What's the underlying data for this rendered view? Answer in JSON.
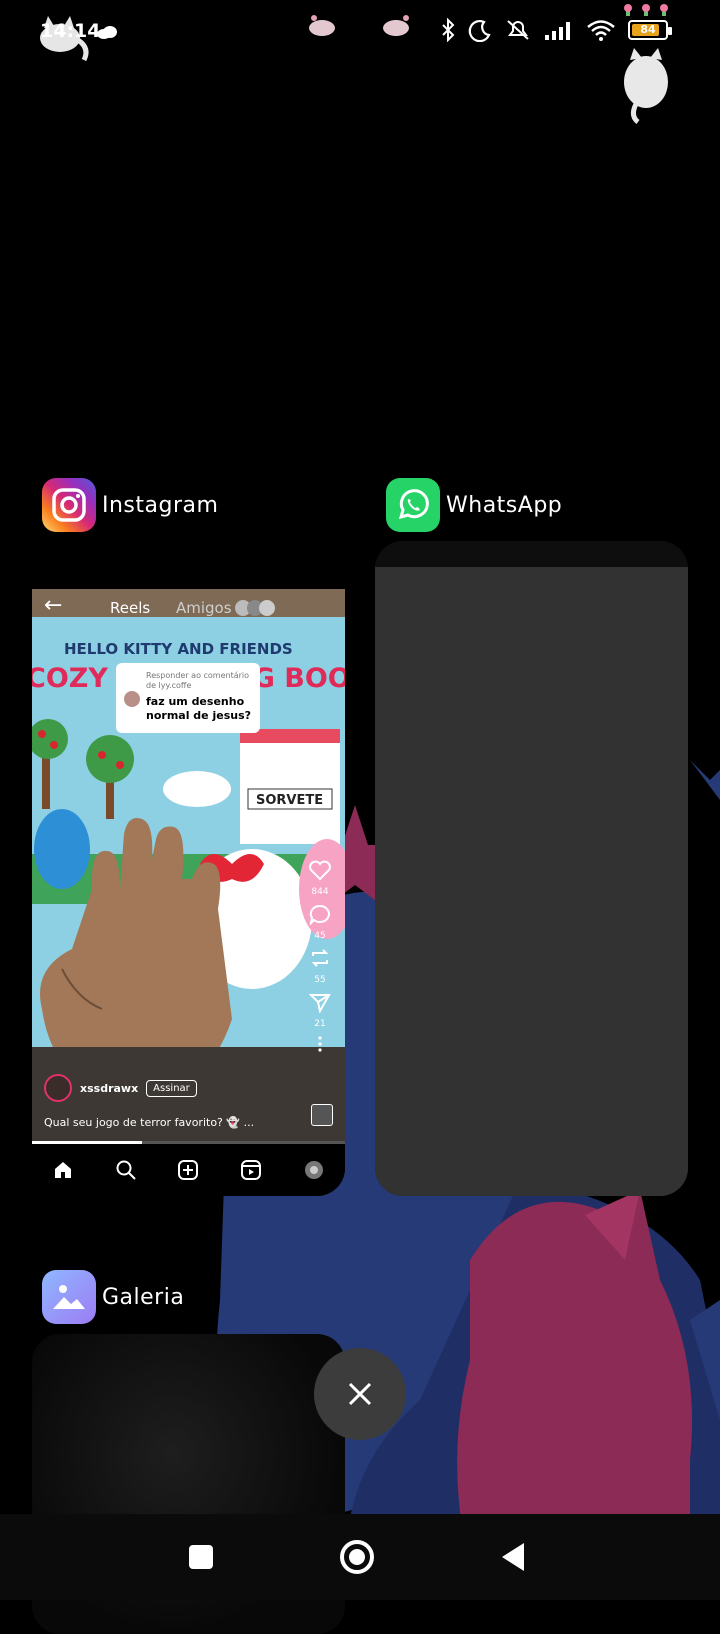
{
  "status_bar": {
    "time": "14:14",
    "battery_level": "84",
    "battery_fraction": 0.84,
    "icons": [
      "bluetooth-icon",
      "do-not-disturb-icon",
      "muted-alarm-icon",
      "signal-icon",
      "wifi-icon",
      "battery-icon"
    ]
  },
  "recents": {
    "apps": [
      {
        "name": "Instagram",
        "icon": "instagram-icon"
      },
      {
        "name": "WhatsApp",
        "icon": "whatsapp-icon"
      },
      {
        "name": "Galeria",
        "icon": "gallery-icon"
      }
    ]
  },
  "instagram_preview": {
    "tab_reels": "Reels",
    "tab_amigos": "Amigos",
    "comment_meta": "Responder ao comentário de lyy.coffe",
    "comment_text": "faz um desenho normal de jesus?",
    "book_title_line1": "HELLO KITTY AND FRIENDS",
    "book_title_line2": "COZY COLORING BOOK",
    "shop_sign": "SORVETE",
    "counts": {
      "likes": "844",
      "comments": "45",
      "reposts": "55",
      "shares": "21"
    },
    "username": "xssdrawx",
    "follow_label": "Assinar",
    "caption": "Qual seu jogo de terror favorito? 👻 ...",
    "progress_fraction": 0.35
  },
  "colors": {
    "accent_card": "#3c3c3c",
    "whatsapp_green": "#25d366",
    "battery_fill": "#e9a21c"
  }
}
